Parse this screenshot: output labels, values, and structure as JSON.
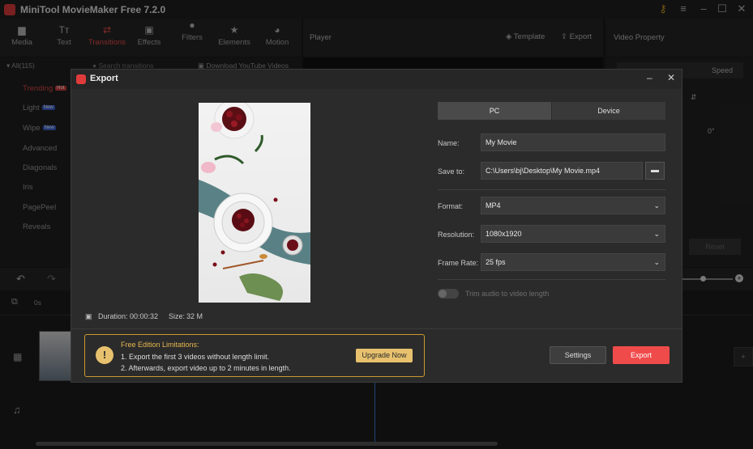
{
  "app": {
    "title": "MiniTool MovieMaker Free 7.2.0"
  },
  "toolbar": {
    "items": [
      {
        "label": "Media"
      },
      {
        "label": "Text"
      },
      {
        "label": "Transitions"
      },
      {
        "label": "Effects"
      },
      {
        "label": "Filters"
      },
      {
        "label": "Elements"
      },
      {
        "label": "Motion"
      }
    ]
  },
  "player": {
    "label": "Player",
    "template": "Template",
    "export": "Export"
  },
  "video_property": {
    "label": "Video Property",
    "speed_tab": "Speed",
    "rotation": "0°",
    "reset": "Reset"
  },
  "transitions": {
    "all": "All(115)",
    "search_placeholder": "Search transitions",
    "download": "Download YouTube Videos",
    "categories": [
      {
        "label": "Trending",
        "badge": "Hot"
      },
      {
        "label": "Light",
        "badge": "New"
      },
      {
        "label": "Wipe",
        "badge": "New"
      },
      {
        "label": "Advanced"
      },
      {
        "label": "Diagonals"
      },
      {
        "label": "Iris"
      },
      {
        "label": "PagePeel"
      },
      {
        "label": "Reveals"
      }
    ]
  },
  "timeline": {
    "time_start": "0s"
  },
  "dialog": {
    "title": "Export",
    "tabs": [
      "PC",
      "Device"
    ],
    "name_label": "Name:",
    "name_value": "My Movie",
    "save_label": "Save to:",
    "save_value": "C:\\Users\\bj\\Desktop\\My Movie.mp4",
    "format_label": "Format:",
    "format_value": "MP4",
    "resolution_label": "Resolution:",
    "resolution_value": "1080x1920",
    "framerate_label": "Frame Rate:",
    "framerate_value": "25 fps",
    "trim_label": "Trim audio to video length",
    "duration_label": "Duration:",
    "duration_value": "00:00:32",
    "size_label": "Size:",
    "size_value": "32 M",
    "limits_title": "Free Edition Limitations:",
    "limit1": "1. Export the first 3 videos without length limit.",
    "limit2": "2. Afterwards, export video up to 2 minutes in length.",
    "upgrade": "Upgrade Now",
    "settings": "Settings",
    "export": "Export"
  },
  "colors": {
    "accent": "#f04b4b",
    "warning": "#c99a2e",
    "upgrade_bg": "#e7c16e"
  }
}
